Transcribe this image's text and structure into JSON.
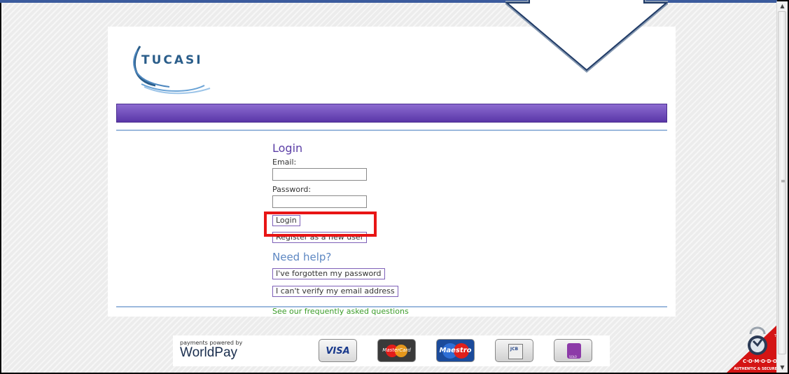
{
  "brand": {
    "name": "TUCASI"
  },
  "login": {
    "title": "Login",
    "email_label": "Email:",
    "email_value": "",
    "password_label": "Password:",
    "password_value": "",
    "login_button": "Login",
    "register_button": "Register as a new user"
  },
  "help": {
    "title": "Need help?",
    "forgot_password": "I've forgotten my password",
    "verify_email": "I can't verify my email address",
    "faq_link": "See our frequently asked questions"
  },
  "payments": {
    "powered_by": "payments powered by",
    "provider": "WorldPay",
    "cards": [
      "VISA",
      "MasterCard",
      "Maestro",
      "JCB",
      "SOLO"
    ]
  },
  "seal": {
    "name": "C·O·M·O·D·O",
    "tagline": "AUTHENTIC & SECURE",
    "tm": "TM"
  },
  "colors": {
    "accent_purple": "#5b3ea6",
    "help_blue": "#5d87c2",
    "faq_green": "#3b9c29",
    "highlight_red": "#e81515"
  }
}
